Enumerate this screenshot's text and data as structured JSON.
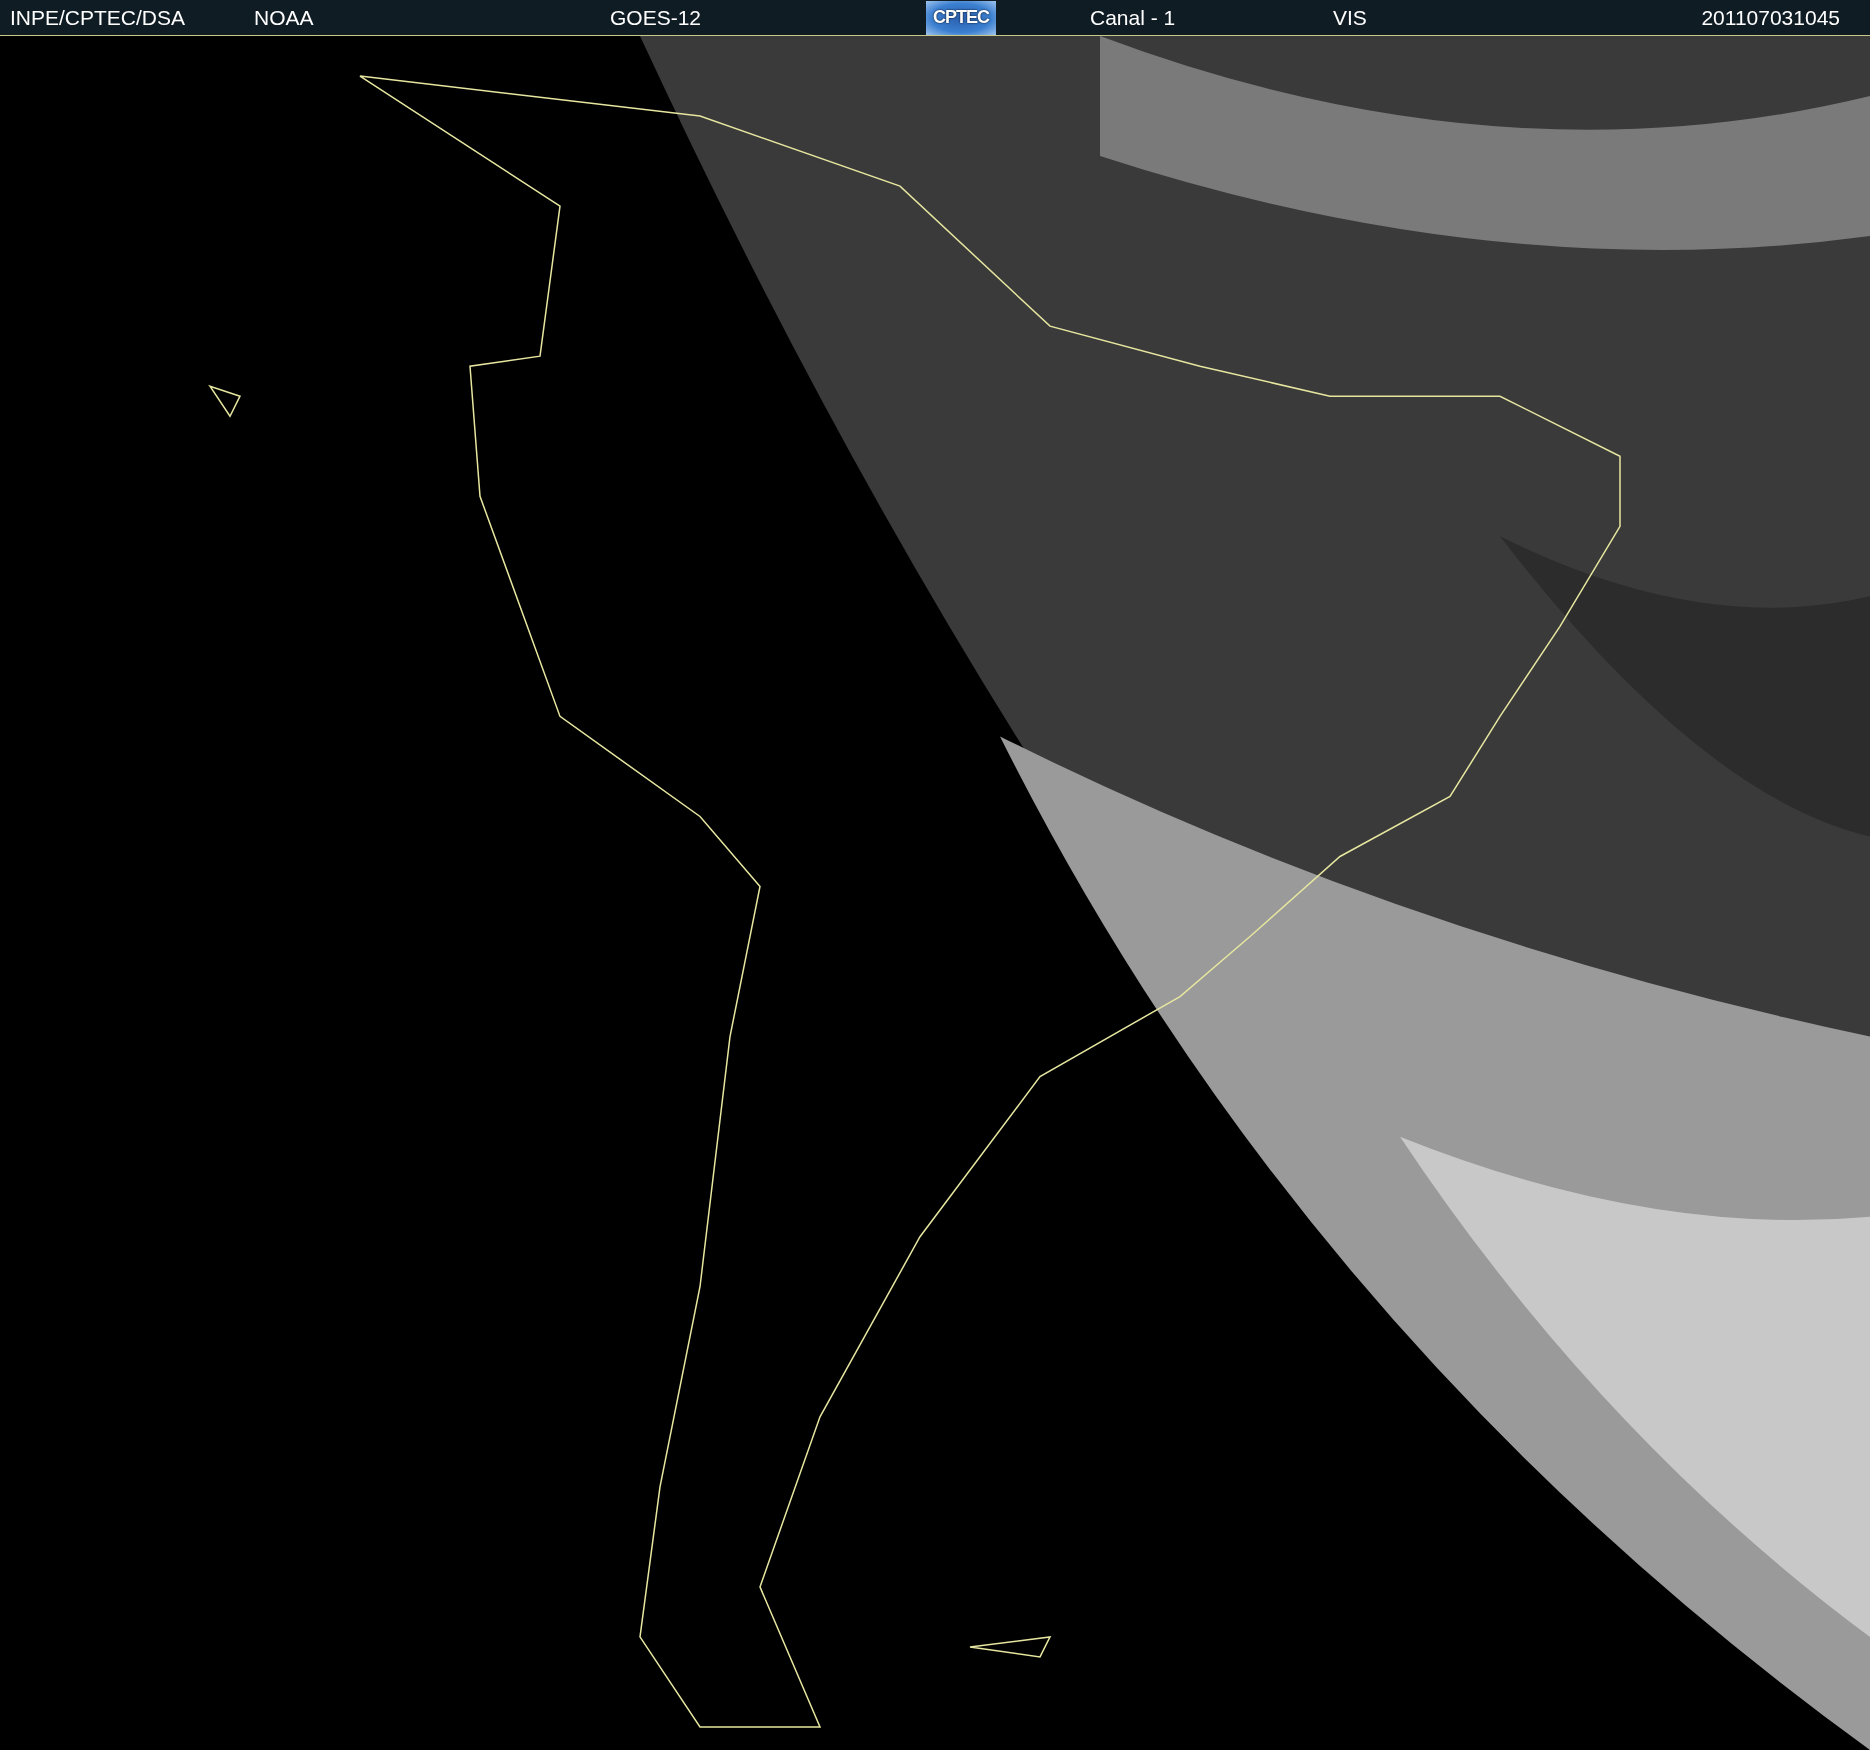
{
  "header": {
    "source": "INPE/CPTEC/DSA",
    "agency": "NOAA",
    "satellite": "GOES-12",
    "logo": "CPTEC",
    "channel": "Canal - 1",
    "band": "VIS",
    "timestamp": "201107031045"
  }
}
